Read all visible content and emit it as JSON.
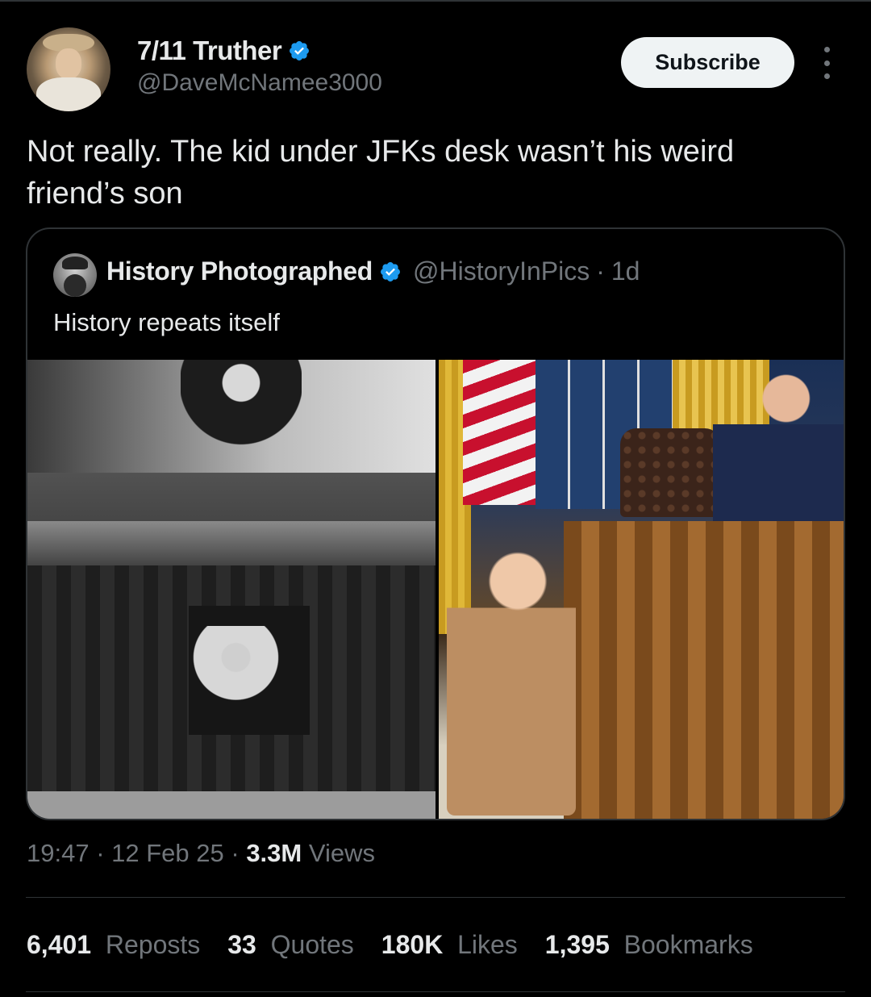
{
  "author": {
    "display_name": "7/11 Truther",
    "handle": "@DaveMcNamee3000",
    "verified": true
  },
  "actions": {
    "subscribe_label": "Subscribe",
    "more_icon": "more-vertical-icon"
  },
  "tweet": {
    "text": "Not really. The kid under JFKs desk wasn’t his weird friend’s son"
  },
  "quoted": {
    "display_name": "History Photographed",
    "handle": "@HistoryInPics",
    "separator": "·",
    "age": "1d",
    "text": "History repeats itself"
  },
  "meta": {
    "time": "19:47",
    "sep1": " · ",
    "date": "12 Feb 25",
    "sep2": " · ",
    "views_count": "3.3M",
    "views_label": " Views"
  },
  "stats": [
    {
      "count": "6,401",
      "label": "Reposts"
    },
    {
      "count": "33",
      "label": "Quotes"
    },
    {
      "count": "180K",
      "label": "Likes"
    },
    {
      "count": "1,395",
      "label": "Bookmarks"
    }
  ],
  "colors": {
    "background": "#000000",
    "text": "#e7e9ea",
    "muted": "#71767b",
    "verified_blue": "#1d9bf0",
    "border": "#2f3336"
  }
}
